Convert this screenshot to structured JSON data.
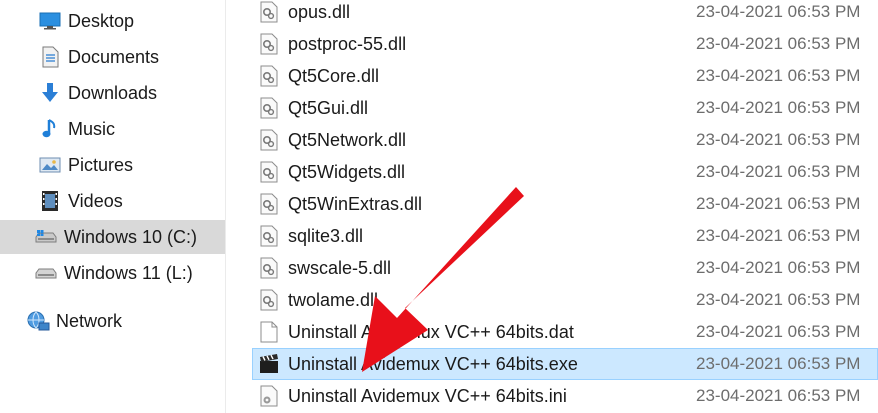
{
  "sidebar": {
    "items": [
      {
        "label": "Desktop",
        "icon": "desktop-icon"
      },
      {
        "label": "Documents",
        "icon": "documents-icon"
      },
      {
        "label": "Downloads",
        "icon": "downloads-icon"
      },
      {
        "label": "Music",
        "icon": "music-icon"
      },
      {
        "label": "Pictures",
        "icon": "pictures-icon"
      },
      {
        "label": "Videos",
        "icon": "videos-icon"
      },
      {
        "label": "Windows 10 (C:)",
        "icon": "drive-c-icon",
        "selected": true
      },
      {
        "label": "Windows 11 (L:)",
        "icon": "drive-l-icon"
      },
      {
        "label": "Network",
        "icon": "network-icon"
      }
    ]
  },
  "files": [
    {
      "name": "opus.dll",
      "date": "23-04-2021 06:53 PM",
      "icon": "dll-file-icon"
    },
    {
      "name": "postproc-55.dll",
      "date": "23-04-2021 06:53 PM",
      "icon": "dll-file-icon"
    },
    {
      "name": "Qt5Core.dll",
      "date": "23-04-2021 06:53 PM",
      "icon": "dll-file-icon"
    },
    {
      "name": "Qt5Gui.dll",
      "date": "23-04-2021 06:53 PM",
      "icon": "dll-file-icon"
    },
    {
      "name": "Qt5Network.dll",
      "date": "23-04-2021 06:53 PM",
      "icon": "dll-file-icon"
    },
    {
      "name": "Qt5Widgets.dll",
      "date": "23-04-2021 06:53 PM",
      "icon": "dll-file-icon"
    },
    {
      "name": "Qt5WinExtras.dll",
      "date": "23-04-2021 06:53 PM",
      "icon": "dll-file-icon"
    },
    {
      "name": "sqlite3.dll",
      "date": "23-04-2021 06:53 PM",
      "icon": "dll-file-icon"
    },
    {
      "name": "swscale-5.dll",
      "date": "23-04-2021 06:53 PM",
      "icon": "dll-file-icon"
    },
    {
      "name": "twolame.dll",
      "date": "23-04-2021 06:53 PM",
      "icon": "dll-file-icon"
    },
    {
      "name": "Uninstall Avidemux VC++ 64bits.dat",
      "date": "23-04-2021 06:53 PM",
      "icon": "blank-file-icon"
    },
    {
      "name": "Uninstall Avidemux VC++ 64bits.exe",
      "date": "23-04-2021 06:53 PM",
      "icon": "clapperboard-exe-icon",
      "selected": true
    },
    {
      "name": "Uninstall Avidemux VC++ 64bits.ini",
      "date": "23-04-2021 06:53 PM",
      "icon": "ini-settings-file-icon"
    }
  ],
  "colors": {
    "selection": "#cce8ff",
    "sidebar_selection": "#d9d9d9",
    "annotation_arrow": "#e8101a"
  }
}
